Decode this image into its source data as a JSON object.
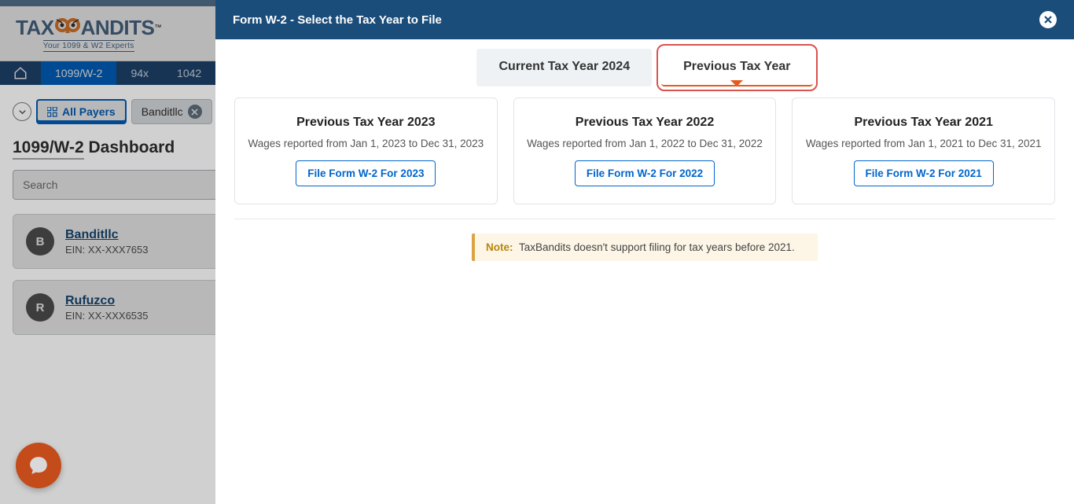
{
  "logo": {
    "word1": "TAX",
    "word2": "ANDITS",
    "tag": "Your 1099 & W2 Experts",
    "tm": "™"
  },
  "nav": {
    "tabs": [
      "1099/W-2",
      "94x",
      "1042"
    ]
  },
  "filters": {
    "all_payers": "All Payers",
    "chip": "Banditllc"
  },
  "dashboard": {
    "title_a": "1099",
    "title_b": "/W-2",
    "title_c": " Dashboard"
  },
  "search": {
    "placeholder": "Search"
  },
  "payers": [
    {
      "initial": "B",
      "name": "Banditllc",
      "ein": "EIN: XX-XXX7653"
    },
    {
      "initial": "R",
      "name": "Rufuzco",
      "ein": "EIN: XX-XXX6535"
    }
  ],
  "modal": {
    "title": "Form W-2 - Select the Tax Year to File",
    "tabs": {
      "current": "Current Tax Year 2024",
      "previous": "Previous Tax Year"
    },
    "cards": [
      {
        "title": "Previous Tax Year 2023",
        "sub": "Wages reported from Jan 1, 2023 to Dec 31, 2023",
        "btn": "File Form W-2 For 2023"
      },
      {
        "title": "Previous Tax Year 2022",
        "sub": "Wages reported from Jan 1, 2022 to Dec 31, 2022",
        "btn": "File Form W-2 For 2022"
      },
      {
        "title": "Previous Tax Year 2021",
        "sub": "Wages reported from Jan 1, 2021 to Dec 31, 2021",
        "btn": "File Form W-2 For 2021"
      }
    ],
    "note_label": "Note:",
    "note_text": "TaxBandits doesn't support filing for tax years before 2021."
  }
}
